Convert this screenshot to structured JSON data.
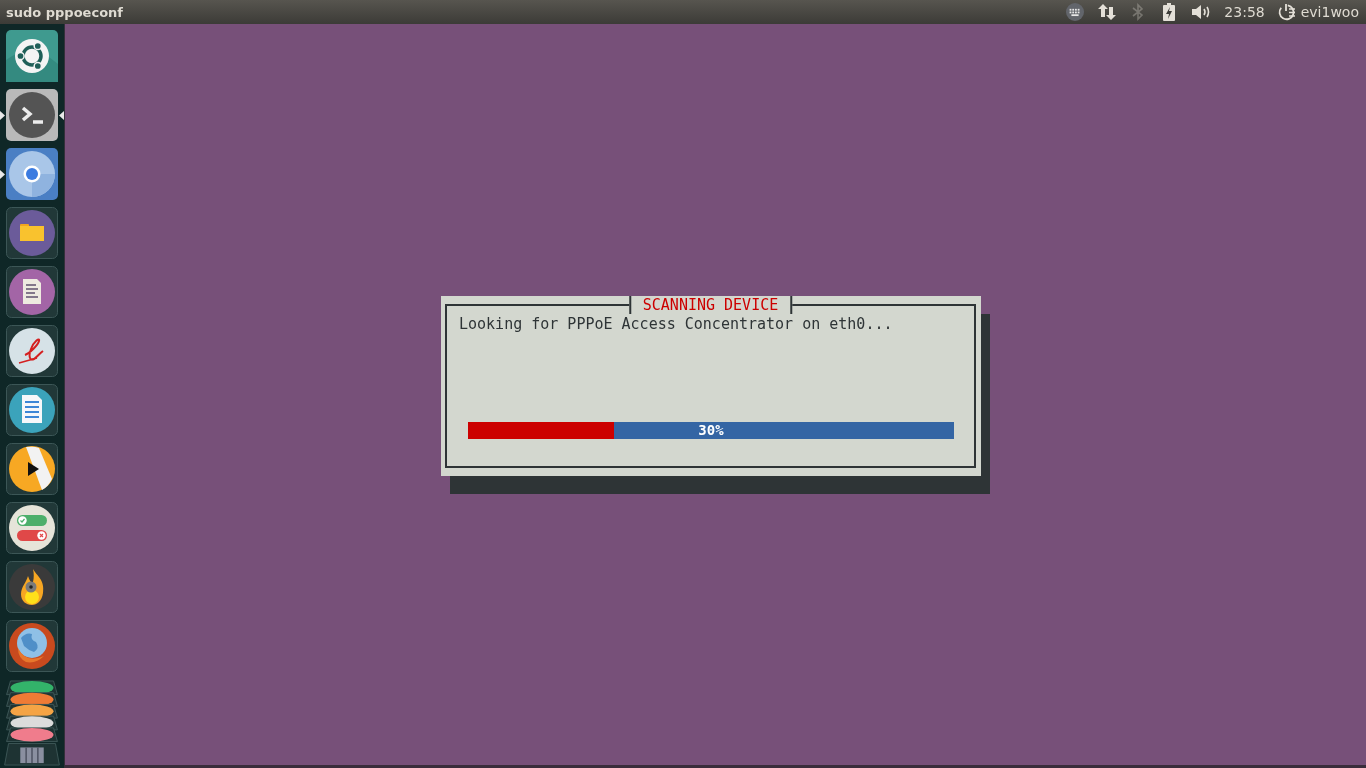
{
  "top_panel": {
    "title": "sudo pppoeconf",
    "indicators": [
      {
        "kind": "keyboard",
        "disabled": false
      },
      {
        "kind": "network",
        "disabled": false
      },
      {
        "kind": "bluetooth",
        "disabled": true
      },
      {
        "kind": "battery",
        "disabled": false
      },
      {
        "kind": "volume",
        "disabled": false
      }
    ],
    "clock": "23:58",
    "user": "evi1woo"
  },
  "launcher": {
    "items": [
      {
        "kind": "logo",
        "running": false,
        "focused": false
      },
      {
        "kind": "terminal",
        "running": true,
        "focused": true
      },
      {
        "kind": "browser",
        "running": true,
        "focused": false
      },
      {
        "kind": "folder",
        "running": false,
        "focused": false
      },
      {
        "kind": "notes",
        "running": false,
        "focused": false
      },
      {
        "kind": "signature",
        "running": false,
        "focused": false
      },
      {
        "kind": "document",
        "running": false,
        "focused": false
      },
      {
        "kind": "player",
        "running": false,
        "focused": false
      },
      {
        "kind": "toggles",
        "running": false,
        "focused": false
      },
      {
        "kind": "burner",
        "running": false,
        "focused": false
      },
      {
        "kind": "globe",
        "running": false,
        "focused": false
      }
    ]
  },
  "dialog": {
    "title": "SCANNING DEVICE",
    "message": "Looking for PPPoE Access Concentrator on eth0...",
    "progress": {
      "level": 0.3,
      "label": "30%"
    }
  }
}
